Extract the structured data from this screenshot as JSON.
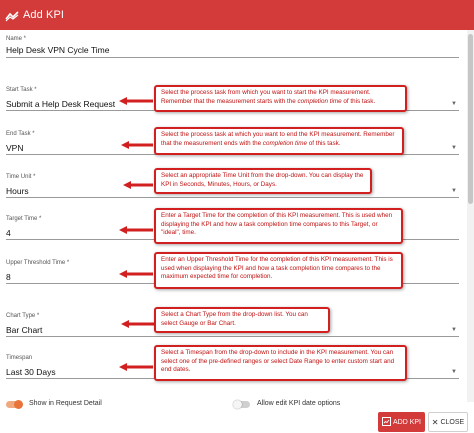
{
  "dialog": {
    "title": "Add KPI",
    "accent_color": "#d33b3b",
    "title_icon": "kpi-chart-icon"
  },
  "fields": {
    "name": {
      "label": "Name *",
      "value": "Help Desk VPN Cycle Time"
    },
    "start_task": {
      "label": "Start Task *",
      "value": "Submit a Help Desk Request"
    },
    "end_task": {
      "label": "End Task *",
      "value": "VPN"
    },
    "time_unit": {
      "label": "Time Unit *",
      "value": "Hours"
    },
    "target_time": {
      "label": "Target Time *",
      "value": "4"
    },
    "upper_threshold": {
      "label": "Upper Threshold Time *",
      "value": "8"
    },
    "chart_type": {
      "label": "Chart Type *",
      "value": "Bar Chart"
    },
    "timespan": {
      "label": "Timespan",
      "value": "Last 30 Days"
    }
  },
  "callouts": {
    "start_task": {
      "pre": "Select the process task from which you want to start the KPI measurement. Remember that the measurement starts with the ",
      "em": "completion time",
      "post": " of this task."
    },
    "end_task": {
      "pre": "Select the process task at which you want to end the KPI measurement. Remember that the measurement ends with the ",
      "em": "completion time",
      "post": " of this task."
    },
    "time_unit": {
      "text": "Select an appropriate Time Unit from the drop-down.  You can display the KPI in Seconds, Minutes, Hours, or Days."
    },
    "target_time": {
      "text": "Enter a Target Time for the completion of this KPI measurement.  This is used when displaying the KPI and how a task completion time compares to this Target, or \"ideal\", time."
    },
    "upper_threshold": {
      "text": "Enter an Upper Threshold Time for the completion of this KPI measurement. This is used when displaying the KPI and how a task completion time compares to the maximum expected time for completion."
    },
    "chart_type": {
      "text": "Select a Chart Type from the drop-down list.  You can select Gauge or Bar Chart."
    },
    "timespan": {
      "text": "Select a Timespan from the drop-down to include in the KPI measurement. You can select one of the pre-defined ranges or select Date Range to enter custom start and end dates."
    }
  },
  "toggles": {
    "show_in_request_detail": {
      "label": "Show in Request Detail",
      "on": true
    },
    "allow_edit_kpi_date": {
      "label": "Allow edit KPI date options",
      "on": false
    }
  },
  "buttons": {
    "add_kpi": "ADD KPI",
    "close": "CLOSE"
  },
  "colors": {
    "callout_border": "#d22020",
    "callout_text": "#c01010",
    "arrow": "#d22020",
    "toggle_on": "#e8743b"
  }
}
